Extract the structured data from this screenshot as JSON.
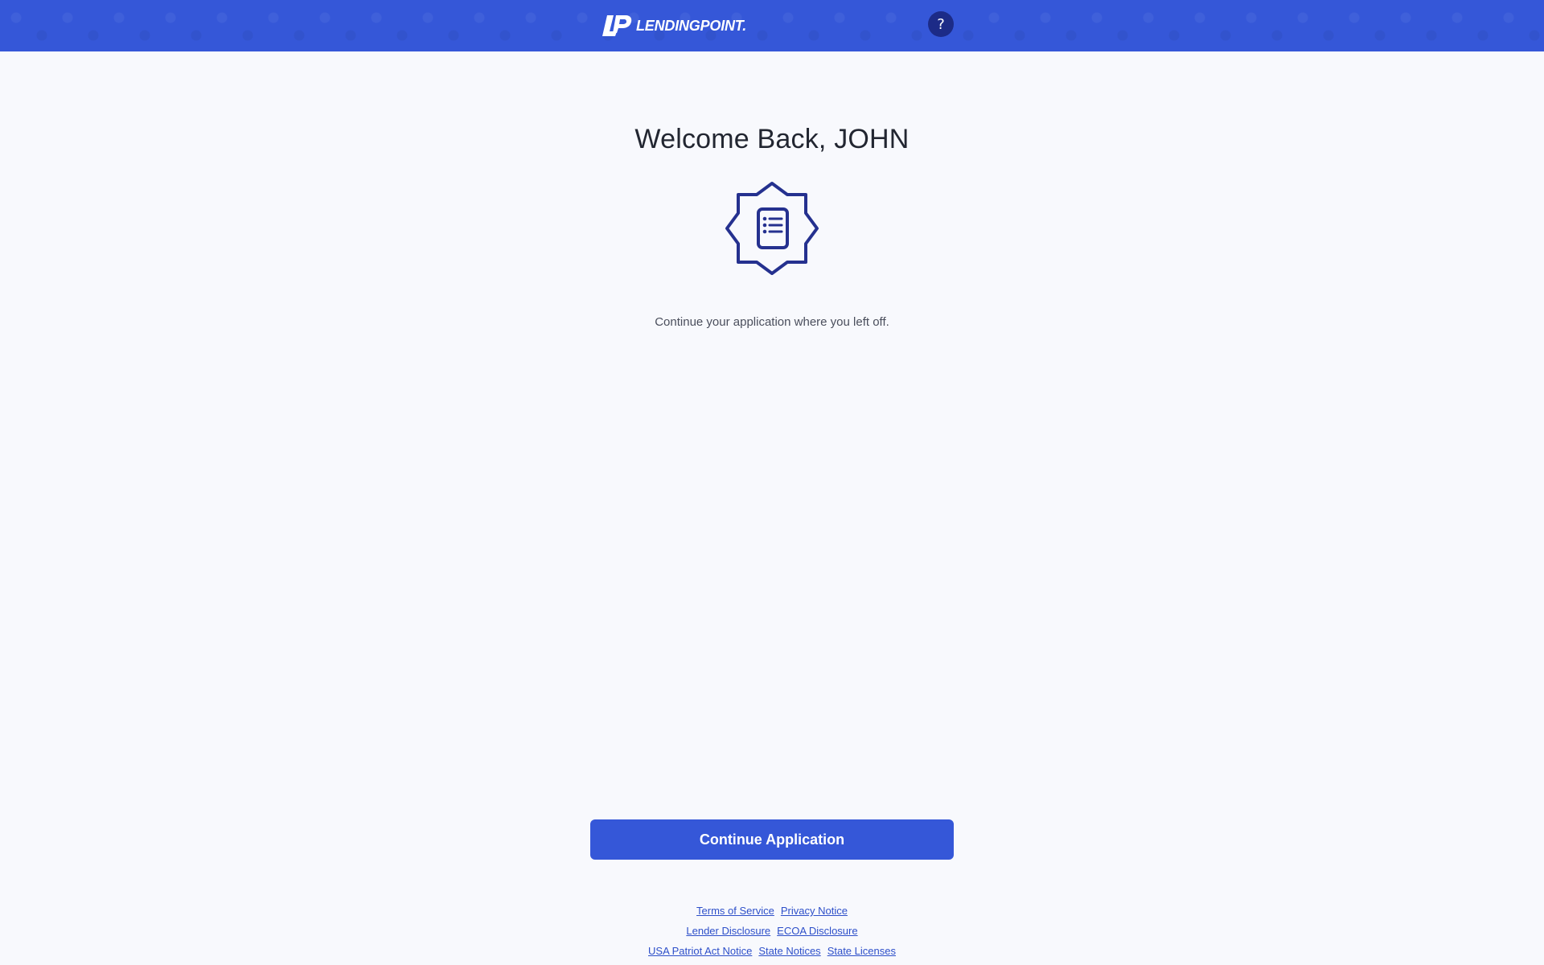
{
  "header": {
    "logo_text": "LENDINGPOINT.",
    "help_label": "?",
    "brand_color": "#3557d8",
    "help_color": "#1c2b87"
  },
  "main": {
    "title": "Welcome Back, JOHN",
    "icon": "document-list-badge-icon",
    "subtitle": "Continue your application where you left off.",
    "continue_label": "Continue Application"
  },
  "footer": {
    "links": {
      "terms": "Terms of Service",
      "privacy": "Privacy Notice",
      "lender": "Lender Disclosure",
      "ecoa": "ECOA Disclosure",
      "patriot": "USA Patriot Act Notice",
      "state_notices": "State Notices",
      "state_licenses": "State Licenses"
    },
    "link_color": "#2d4fc9"
  },
  "colors": {
    "page_background": "#f8f9fd",
    "icon_stroke": "#25318f",
    "title_text": "#222631"
  }
}
